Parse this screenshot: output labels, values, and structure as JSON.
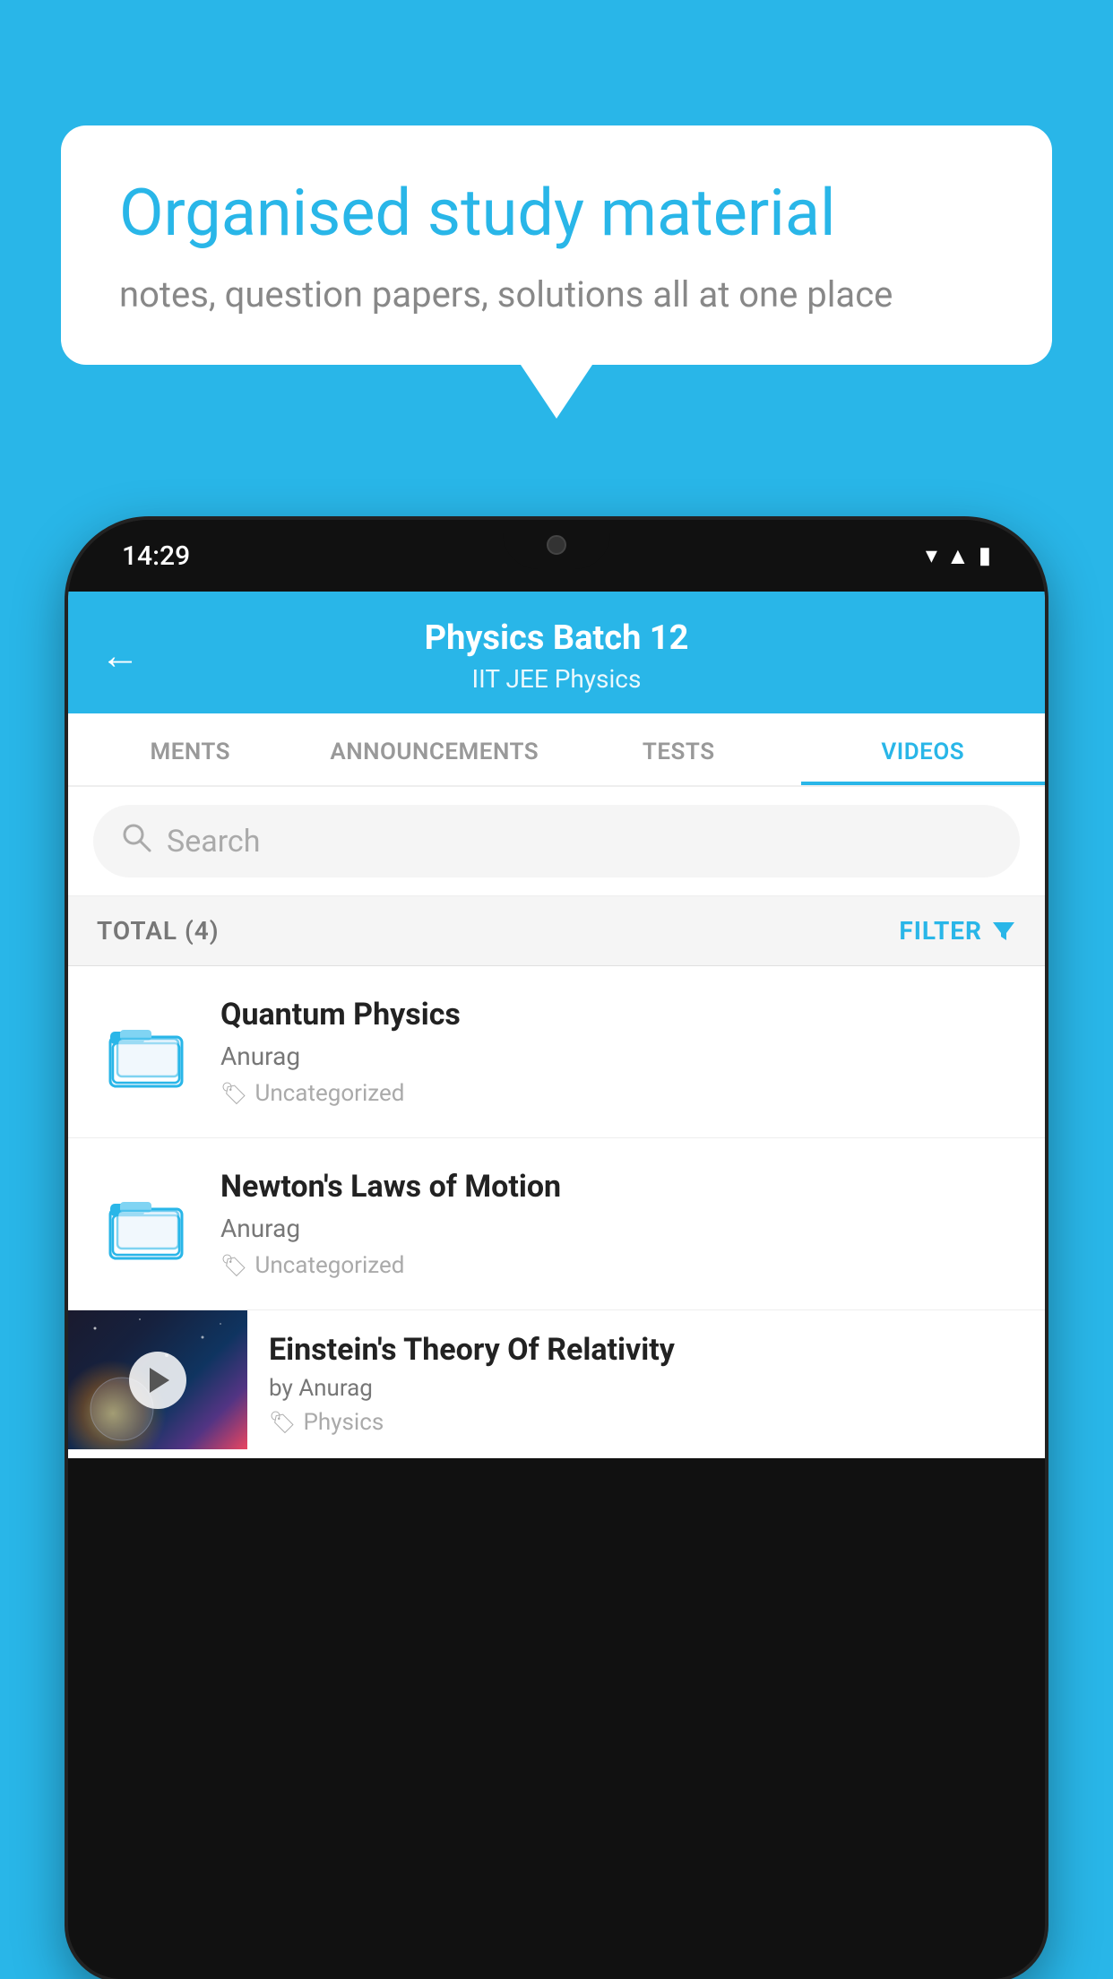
{
  "background_color": "#29b6e8",
  "speech_bubble": {
    "title": "Organised study material",
    "subtitle": "notes, question papers, solutions all at one place"
  },
  "phone": {
    "status_bar": {
      "time": "14:29"
    },
    "app_bar": {
      "title": "Physics Batch 12",
      "subtitle": "IIT JEE   Physics",
      "back_label": "←"
    },
    "tabs": [
      {
        "label": "MENTS",
        "active": false
      },
      {
        "label": "ANNOUNCEMENTS",
        "active": false
      },
      {
        "label": "TESTS",
        "active": false
      },
      {
        "label": "VIDEOS",
        "active": true
      }
    ],
    "search": {
      "placeholder": "Search"
    },
    "filter_bar": {
      "total_label": "TOTAL (4)",
      "filter_label": "FILTER"
    },
    "video_items": [
      {
        "id": 1,
        "title": "Quantum Physics",
        "author": "Anurag",
        "tag": "Uncategorized",
        "has_thumb": false
      },
      {
        "id": 2,
        "title": "Newton's Laws of Motion",
        "author": "Anurag",
        "tag": "Uncategorized",
        "has_thumb": false
      },
      {
        "id": 3,
        "title": "Einstein's Theory Of Relativity",
        "author": "by Anurag",
        "tag": "Physics",
        "has_thumb": true
      }
    ]
  }
}
